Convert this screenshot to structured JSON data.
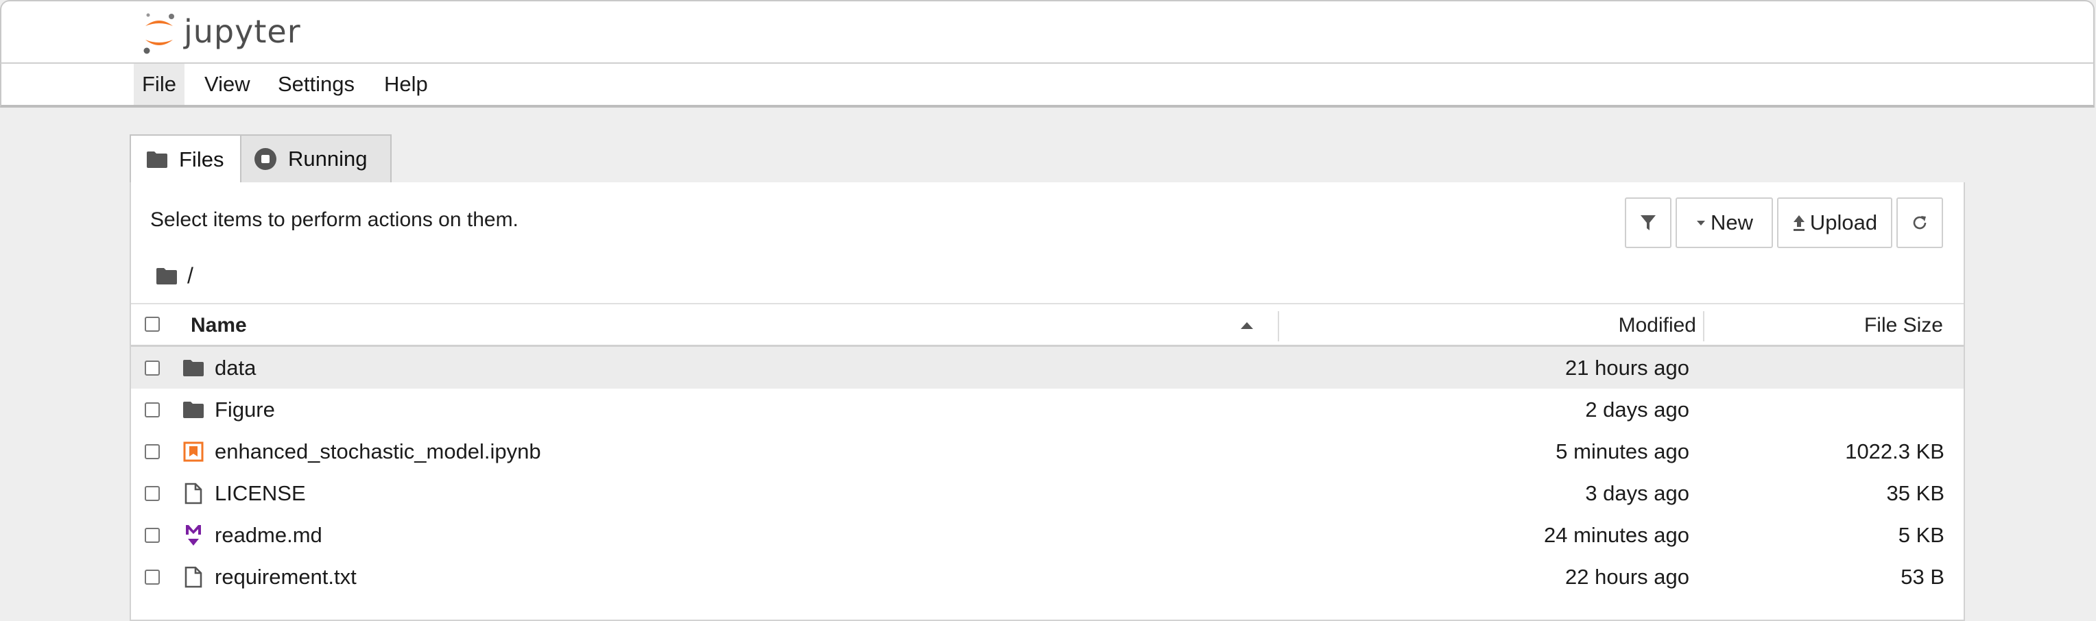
{
  "app": {
    "logo_text": "jupyter",
    "brand_color": "#F37726"
  },
  "menu": {
    "items": [
      {
        "label": "File",
        "active": true
      },
      {
        "label": "View"
      },
      {
        "label": "Settings"
      },
      {
        "label": "Help"
      }
    ]
  },
  "tabs": [
    {
      "label": "Files",
      "icon": "folder-icon",
      "active": true
    },
    {
      "label": "Running",
      "icon": "stop-circle-icon",
      "active": false
    }
  ],
  "browser": {
    "hint": "Select items to perform actions on them.",
    "toolbar": {
      "filter_icon": "filter-icon",
      "new_label": "New",
      "upload_label": "Upload",
      "refresh_icon": "refresh-icon"
    },
    "breadcrumb": {
      "root_icon": "folder-icon",
      "path": "/"
    },
    "columns": {
      "name": "Name",
      "modified": "Modified",
      "size": "File Size"
    },
    "files": [
      {
        "name": "data",
        "type": "folder",
        "icon": "folder-icon",
        "modified": "21 hours ago",
        "size": ""
      },
      {
        "name": "Figure",
        "type": "folder",
        "icon": "folder-icon",
        "modified": "2 days ago",
        "size": ""
      },
      {
        "name": "enhanced_stochastic_model.ipynb",
        "type": "notebook",
        "icon": "notebook-icon",
        "modified": "5 minutes ago",
        "size": "1022.3 KB"
      },
      {
        "name": "LICENSE",
        "type": "file",
        "icon": "file-icon",
        "modified": "3 days ago",
        "size": "35 KB"
      },
      {
        "name": "readme.md",
        "type": "markdown",
        "icon": "markdown-icon",
        "modified": "24 minutes ago",
        "size": "5 KB"
      },
      {
        "name": "requirement.txt",
        "type": "file",
        "icon": "file-icon",
        "modified": "22 hours ago",
        "size": "53 B"
      }
    ]
  }
}
